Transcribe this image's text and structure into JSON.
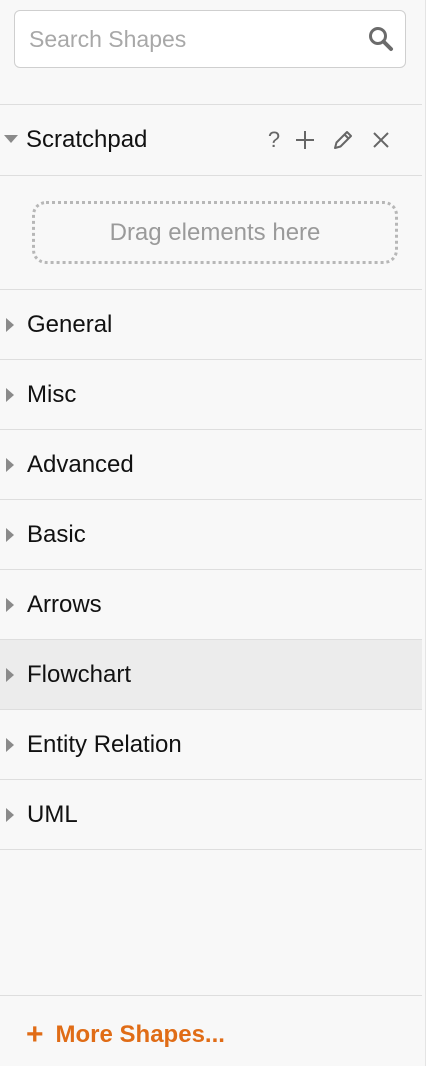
{
  "search": {
    "placeholder": "Search Shapes",
    "icon": "search-icon"
  },
  "scratchpad": {
    "title": "Scratchpad",
    "expanded": true,
    "tools": {
      "help": "?",
      "add": "+",
      "edit": "✎",
      "close": "✕"
    },
    "dropzone_text": "Drag elements here"
  },
  "categories": [
    {
      "label": "General",
      "highlighted": false
    },
    {
      "label": "Misc",
      "highlighted": false
    },
    {
      "label": "Advanced",
      "highlighted": false
    },
    {
      "label": "Basic",
      "highlighted": false
    },
    {
      "label": "Arrows",
      "highlighted": false
    },
    {
      "label": "Flowchart",
      "highlighted": true
    },
    {
      "label": "Entity Relation",
      "highlighted": false
    },
    {
      "label": "UML",
      "highlighted": false
    }
  ],
  "footer": {
    "more_shapes_plus": "+",
    "more_shapes_label": "More Shapes..."
  },
  "colors": {
    "accent": "#e06c16",
    "panel_bg": "#f8f8f8",
    "highlight_bg": "#ececec",
    "divider": "#dedede"
  }
}
